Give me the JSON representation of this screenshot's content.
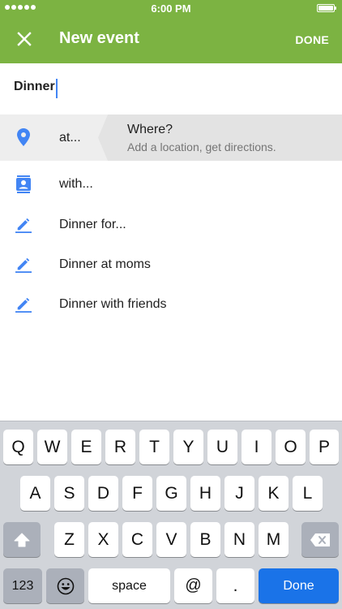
{
  "status_bar": {
    "time": "6:00 PM"
  },
  "app_bar": {
    "title": "New event",
    "done_label": "DONE"
  },
  "event": {
    "title": "Dinner"
  },
  "location_row": {
    "label": "at...",
    "where_title": "Where?",
    "where_subtitle": "Add a location, get directions."
  },
  "suggestions": [
    {
      "label": "with...",
      "icon": "contact-icon"
    },
    {
      "label": "Dinner for...",
      "icon": "pencil-icon"
    },
    {
      "label": "Dinner at moms",
      "icon": "pencil-icon"
    },
    {
      "label": "Dinner with friends",
      "icon": "pencil-icon"
    }
  ],
  "keyboard": {
    "row1": [
      "Q",
      "W",
      "E",
      "R",
      "T",
      "Y",
      "U",
      "I",
      "O",
      "P"
    ],
    "row2": [
      "A",
      "S",
      "D",
      "F",
      "G",
      "H",
      "J",
      "K",
      "L"
    ],
    "row3": [
      "Z",
      "X",
      "C",
      "V",
      "B",
      "N",
      "M"
    ],
    "numbers_label": "123",
    "space_label": "space",
    "at_label": "@",
    "period_label": ".",
    "done_label": "Done"
  },
  "colors": {
    "app_bar": "#7cb342",
    "icon_blue": "#4285f4",
    "done_key": "#1a73e8"
  }
}
